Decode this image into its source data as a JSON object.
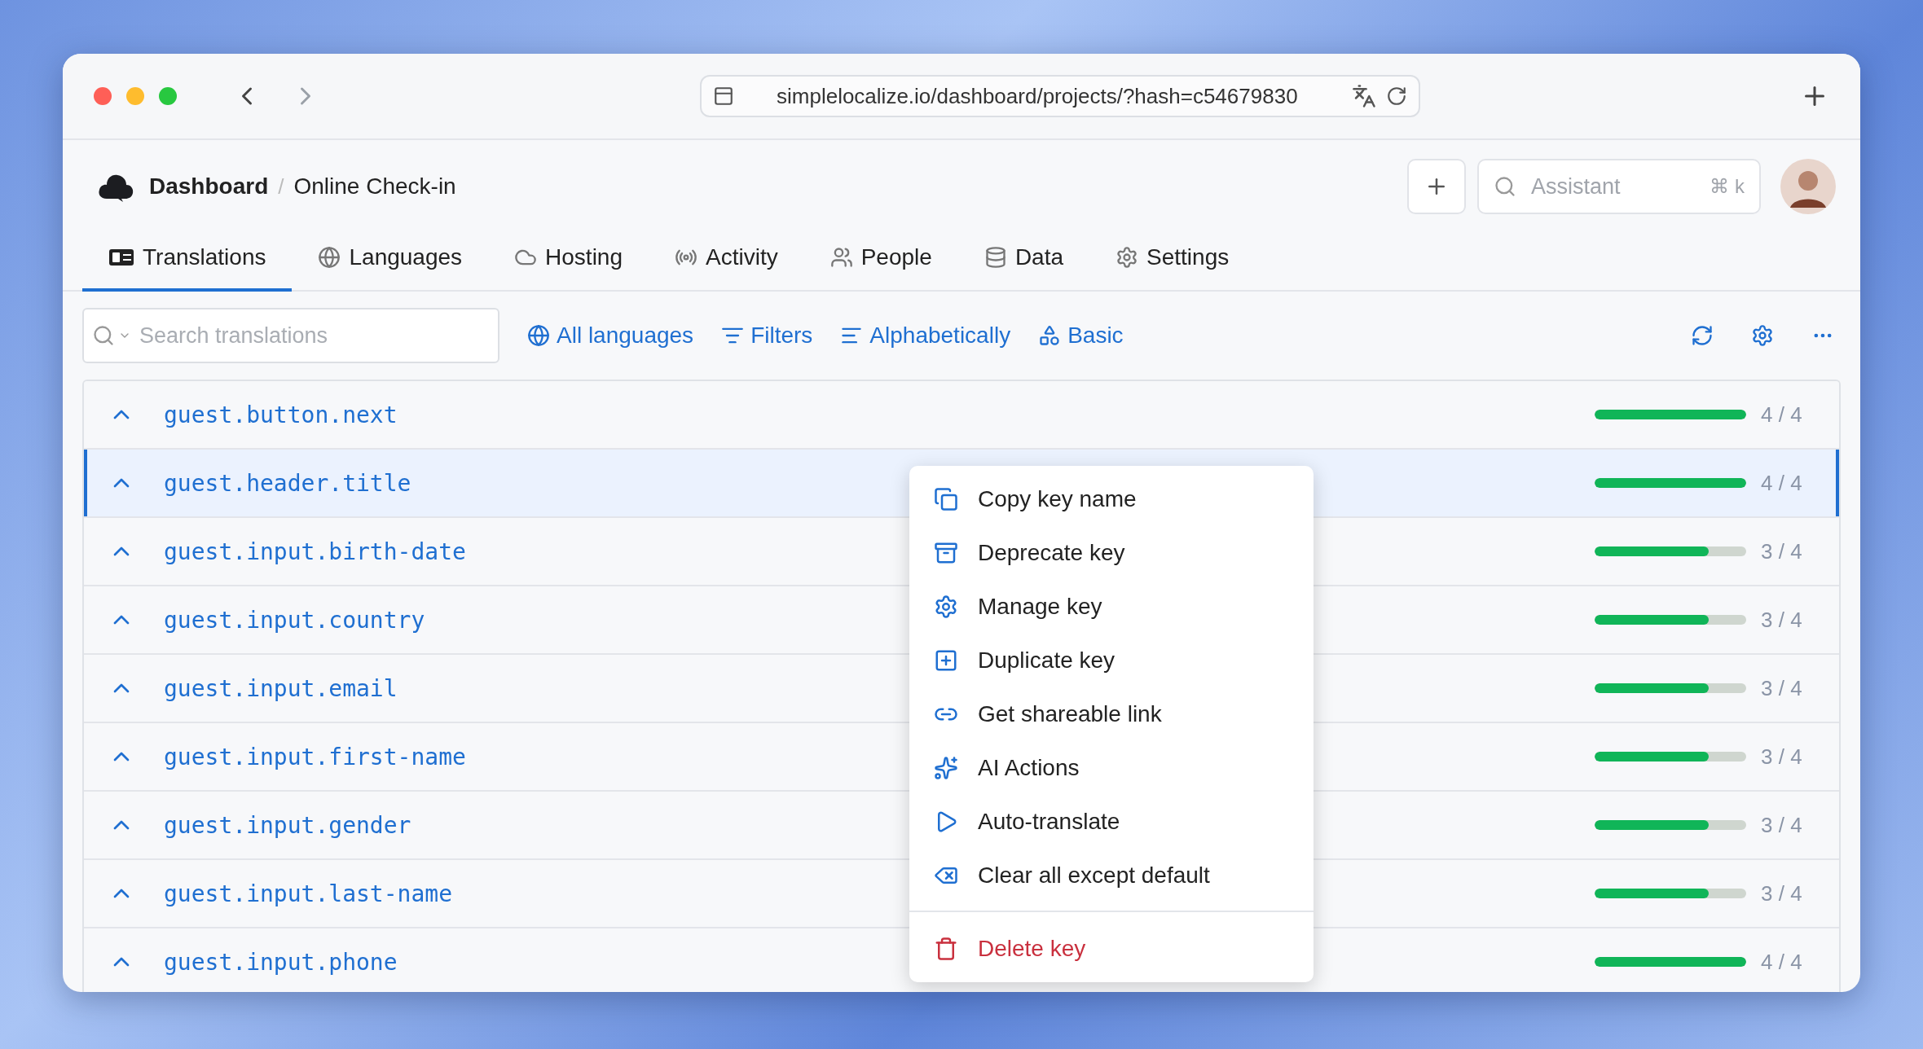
{
  "browser": {
    "url": "simplelocalize.io/dashboard/projects/?hash=c54679830"
  },
  "breadcrumb": {
    "items": [
      "Dashboard",
      "Online Check-in"
    ],
    "separator": "/"
  },
  "assistant": {
    "placeholder": "Assistant",
    "shortcut": "⌘ k"
  },
  "tabs": [
    {
      "label": "Translations",
      "selected": true
    },
    {
      "label": "Languages",
      "selected": false
    },
    {
      "label": "Hosting",
      "selected": false
    },
    {
      "label": "Activity",
      "selected": false
    },
    {
      "label": "People",
      "selected": false
    },
    {
      "label": "Data",
      "selected": false
    },
    {
      "label": "Settings",
      "selected": false
    }
  ],
  "search": {
    "placeholder": "Search translations"
  },
  "filters": [
    "All languages",
    "Filters",
    "Alphabetically",
    "Basic"
  ],
  "rows": [
    {
      "key": "guest.button.next",
      "progress": "4 / 4",
      "level": 1,
      "selected": false
    },
    {
      "key": "guest.header.title",
      "progress": "4 / 4",
      "level": 1,
      "selected": true
    },
    {
      "key": "guest.input.birth-date",
      "progress": "3 / 4",
      "level": 0.75,
      "selected": false
    },
    {
      "key": "guest.input.country",
      "progress": "3 / 4",
      "level": 0.75,
      "selected": false
    },
    {
      "key": "guest.input.email",
      "progress": "3 / 4",
      "level": 0.75,
      "selected": false
    },
    {
      "key": "guest.input.first-name",
      "progress": "3 / 4",
      "level": 0.75,
      "selected": false
    },
    {
      "key": "guest.input.gender",
      "progress": "3 / 4",
      "level": 0.75,
      "selected": false
    },
    {
      "key": "guest.input.last-name",
      "progress": "3 / 4",
      "level": 0.75,
      "selected": false
    },
    {
      "key": "guest.input.phone",
      "progress": "4 / 4",
      "level": 1,
      "selected": false
    }
  ],
  "context_menu": [
    {
      "label": "Copy key name",
      "kind": "item"
    },
    {
      "label": "Deprecate key",
      "kind": "item"
    },
    {
      "label": "Manage key",
      "kind": "item"
    },
    {
      "label": "Duplicate key",
      "kind": "item"
    },
    {
      "label": "Get shareable link",
      "kind": "item"
    },
    {
      "label": "AI Actions",
      "kind": "item"
    },
    {
      "label": "Auto-translate",
      "kind": "item"
    },
    {
      "label": "Clear all except default",
      "kind": "item"
    },
    {
      "label": "Delete key",
      "kind": "danger"
    }
  ]
}
